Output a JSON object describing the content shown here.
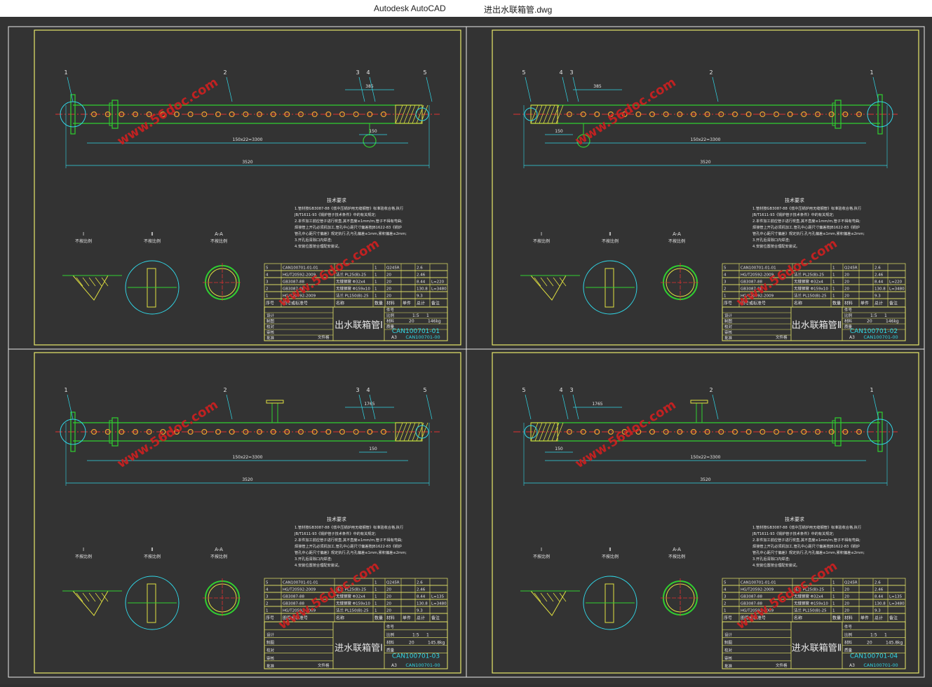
{
  "window": {
    "app_title": "Autodesk AutoCAD",
    "file_title": "进出水联箱管.dwg"
  },
  "colors": {
    "background": "#333333",
    "frame_white": "#e8e8e8",
    "frame_yellow": "#e8e86a",
    "pipe_green": "#30d030",
    "centerline_red": "#e03030",
    "hole_orange": "#f0a030",
    "dimension_cyan": "#30d8e8",
    "hatch_yellow": "#e0e040",
    "watermark_red": "#d02020"
  },
  "watermark": "www.56doc.com",
  "sheets": [
    {
      "title": "出水联箱管Ⅰ",
      "drawing_no": "CAN100701-01",
      "assembly_no": "CAN100701-00",
      "mass": "146kg",
      "scale": "1:5",
      "qty": "1",
      "material_no": "20",
      "paper": "A3",
      "leaders": [
        "1",
        "2",
        "3",
        "4",
        "5"
      ],
      "dims": [
        "385",
        "150",
        "150x22=3300",
        "3520"
      ],
      "views": [
        "Ⅰ",
        "Ⅱ",
        "A-A"
      ],
      "view_note": "不按比例",
      "bom": [
        [
          "5",
          "CAN100701-01-01",
          "",
          "1",
          "Q245R",
          "",
          "2.6",
          ""
        ],
        [
          "4",
          "HG/T20592-2009",
          "法兰 PL25(B)-25",
          "1",
          "20",
          "",
          "2.46",
          ""
        ],
        [
          "3",
          "GB3087-88",
          "无缝钢管 Φ32x4",
          "1",
          "20",
          "",
          "8.44",
          "L=220"
        ],
        [
          "2",
          "GB3087-88",
          "无缝钢管 Φ159x10",
          "1",
          "20",
          "",
          "130.8",
          "L=3480"
        ],
        [
          "1",
          "HG/T20592-2009",
          "法兰 PL150(B)-25",
          "1",
          "20",
          "",
          "9.3",
          ""
        ]
      ]
    },
    {
      "title": "出水联箱管Ⅱ",
      "drawing_no": "CAN100701-02",
      "assembly_no": "CAN100701-00",
      "mass": "146kg",
      "scale": "1:5",
      "qty": "1",
      "material_no": "20",
      "paper": "A3",
      "leaders": [
        "5",
        "4",
        "3",
        "2",
        "1"
      ],
      "dims": [
        "385",
        "150",
        "150x22=3300",
        "3520"
      ],
      "views": [
        "Ⅰ",
        "Ⅱ",
        "A-A"
      ],
      "view_note": "不按比例",
      "bom": [
        [
          "5",
          "CAN100701-01-01",
          "",
          "1",
          "Q245R",
          "",
          "2.6",
          ""
        ],
        [
          "4",
          "HG/T20592-2009",
          "法兰 PL25(B)-25",
          "1",
          "20",
          "",
          "2.46",
          ""
        ],
        [
          "3",
          "GB3087-88",
          "无缝钢管 Φ32x4",
          "1",
          "20",
          "",
          "8.44",
          "L=220"
        ],
        [
          "2",
          "GB3087-88",
          "无缝钢管 Φ159x10",
          "1",
          "20",
          "",
          "130.8",
          "L=3480"
        ],
        [
          "1",
          "HG/T20592-2009",
          "法兰 PL150(B)-25",
          "1",
          "20",
          "",
          "9.3",
          ""
        ]
      ]
    },
    {
      "title": "进水联箱管Ⅰ",
      "drawing_no": "CAN100701-03",
      "assembly_no": "CAN100701-00",
      "mass": "145.8kg",
      "scale": "1:5",
      "qty": "1",
      "material_no": "20",
      "paper": "A3",
      "leaders": [
        "1",
        "2",
        "3",
        "4",
        "5"
      ],
      "dims": [
        "1765",
        "150",
        "150x22=3300",
        "3520"
      ],
      "views": [
        "Ⅰ",
        "Ⅱ",
        "A-A"
      ],
      "view_note": "不按比例",
      "bom": [
        [
          "5",
          "CAN100701-01-01",
          "",
          "1",
          "Q245R",
          "",
          "2.6",
          ""
        ],
        [
          "4",
          "HG/T20592-2009",
          "法兰 PL25(B)-25",
          "1",
          "20",
          "",
          "2.46",
          ""
        ],
        [
          "3",
          "GB3087-88",
          "无缝钢管 Φ32x4",
          "1",
          "20",
          "",
          "8.44",
          "L=135"
        ],
        [
          "2",
          "GB3087-88",
          "无缝钢管 Φ159x10",
          "1",
          "20",
          "",
          "130.8",
          "L=3480"
        ],
        [
          "1",
          "HG/T20592-2009",
          "法兰 PL150(B)-25",
          "1",
          "20",
          "",
          "9.3",
          ""
        ]
      ]
    },
    {
      "title": "进水联箱管Ⅱ",
      "drawing_no": "CAN100701-04",
      "assembly_no": "CAN100701-00",
      "mass": "145.8kg",
      "scale": "1:5",
      "qty": "1",
      "material_no": "20",
      "paper": "A3",
      "leaders": [
        "5",
        "4",
        "3",
        "2",
        "1"
      ],
      "dims": [
        "1765",
        "150",
        "150x22=3300",
        "3520"
      ],
      "views": [
        "Ⅰ",
        "Ⅱ",
        "A-A"
      ],
      "view_note": "不按比例",
      "bom": [
        [
          "5",
          "CAN100701-01-01",
          "",
          "1",
          "Q245R",
          "",
          "2.6",
          ""
        ],
        [
          "4",
          "HG/T20592-2009",
          "法兰 PL25(B)-25",
          "1",
          "20",
          "",
          "2.46",
          ""
        ],
        [
          "3",
          "GB3087-88",
          "无缝钢管 Φ32x4",
          "1",
          "20",
          "",
          "8.44",
          "L=135"
        ],
        [
          "2",
          "GB3087-88",
          "无缝钢管 Φ159x10",
          "1",
          "20",
          "",
          "130.8",
          "L=3480"
        ],
        [
          "1",
          "HG/T20592-2009",
          "法兰 PL150(B)-25",
          "1",
          "20",
          "",
          "9.3",
          ""
        ]
      ]
    }
  ],
  "tech_req": {
    "heading": "技术要求",
    "lines": [
      "1.管材按GB3087-88《低中压锅炉用无缝钢管》标准验收合格,执行",
      "  JB/T1611-93《锅炉管子技术条件》中的有关规定;",
      "2.本件加工前应管子进行校直,其不直度≤1mm/m,管子不得有弯曲;",
      "  焊接管上开孔必须机加工,管孔中心距尺寸偏差按JB1622-83《锅炉",
      "  管孔中心距尺寸偏差》规定执行,孔与孔偏差≤1mm,累积偏差≤2mm;",
      "3.开孔后清除口内焊渣;",
      "4.安装位置按合理配安装试。"
    ]
  },
  "title_block": {
    "labels": [
      "设计",
      "制图",
      "校对",
      "审核",
      "批准",
      "标记",
      "处数",
      "分区",
      "签名",
      "日期"
    ],
    "col_headers": [
      "序号",
      "图号或标准号",
      "名称",
      "数量",
      "材料",
      "单件",
      "总计",
      "备注"
    ],
    "scale_labels": [
      "件号",
      "比例",
      "材料",
      "质量"
    ],
    "weight_col": "重量",
    "paper_label": "文件格"
  }
}
